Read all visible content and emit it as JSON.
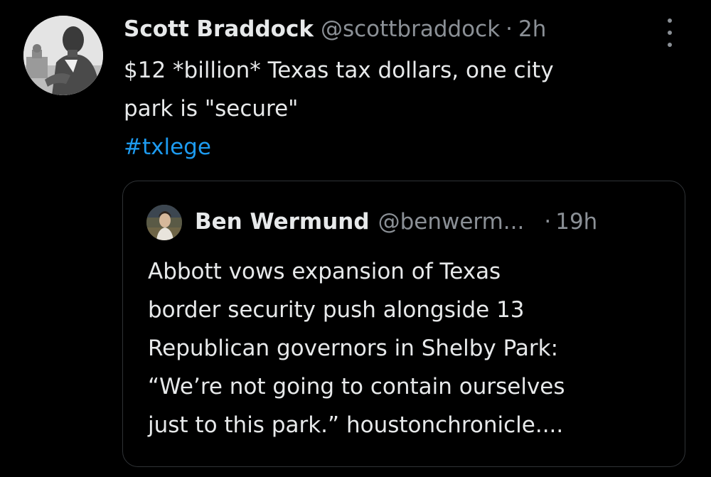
{
  "tweet": {
    "display_name": "Scott Braddock",
    "handle": "@scottbraddock",
    "separator": "·",
    "time": "2h",
    "text_lines": [
      "$12 *billion* Texas tax dollars, one city",
      "park is \"secure\""
    ],
    "hashtag": "#txlege",
    "more_icon": "more-vertical-icon"
  },
  "quoted": {
    "display_name": "Ben Wermund",
    "handle": "@benwerm...",
    "separator": "·",
    "time": "19h",
    "text_lines": [
      "Abbott vows expansion of Texas",
      "border security push alongside 13",
      "Republican governors in Shelby Park:",
      "“We’re not going to contain ourselves",
      "just to this park.” houstonchronicle...."
    ]
  },
  "colors": {
    "background": "#000000",
    "text": "#e7e9ea",
    "secondary": "#8b9096",
    "link": "#1d9bf0",
    "border": "#2f3336"
  }
}
